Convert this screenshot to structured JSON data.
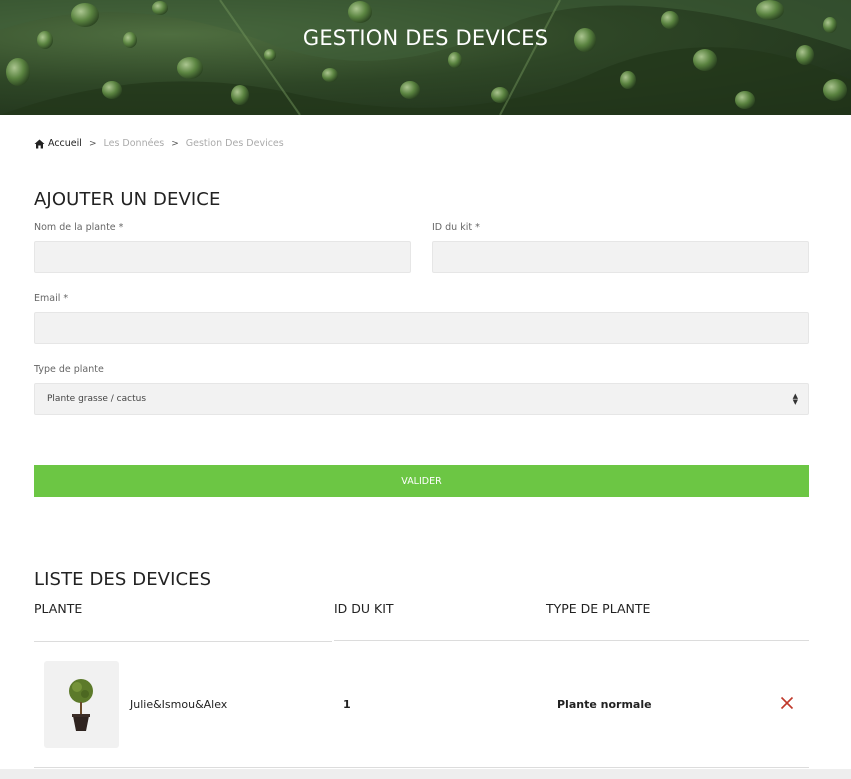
{
  "header": {
    "title": "GESTION DES DEVICES"
  },
  "breadcrumb": {
    "home_icon": "home-icon",
    "home": "Accueil",
    "separator": ">",
    "level1": "Les Données",
    "current": "Gestion Des Devices"
  },
  "form": {
    "title": "AJOUTER UN DEVICE",
    "plant_name_label": "Nom de la plante *",
    "plant_name_value": "",
    "kit_id_label": "ID du kit *",
    "kit_id_value": "",
    "email_label": "Email *",
    "email_value": "",
    "plant_type_label": "Type de plante",
    "plant_type_selected": "Plante grasse / cactus",
    "submit_label": "VALIDER"
  },
  "list": {
    "title": "LISTE DES DEVICES",
    "columns": [
      "PLANTE",
      "ID DU KIT",
      "TYPE DE PLANTE"
    ],
    "rows": [
      {
        "image": "topiary-plant-image",
        "name": "Julie&Ismou&Alex",
        "kit_id": "1",
        "plant_type": "Plante normale",
        "delete_icon": "close-icon"
      }
    ]
  },
  "colors": {
    "accent": "#6cc644",
    "delete": "#c0392b",
    "field_bg": "#f2f2f2"
  }
}
